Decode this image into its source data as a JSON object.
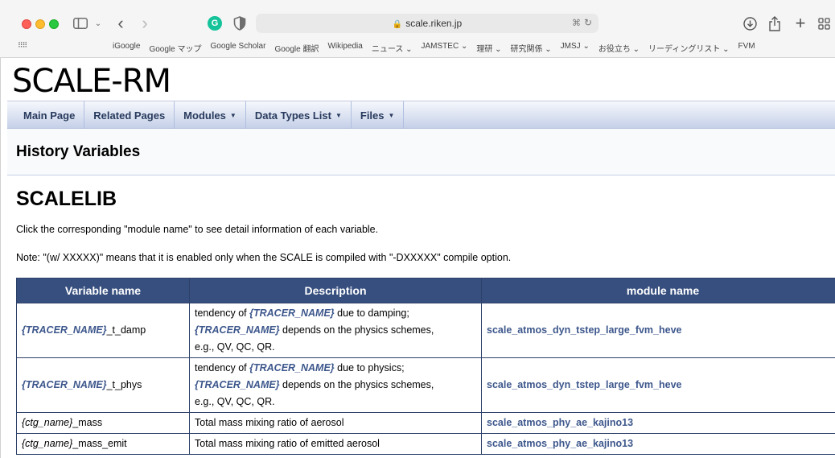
{
  "browser": {
    "url": "scale.riken.jp",
    "grammarly_letter": "G",
    "bookmarks": [
      "iGoogle",
      "Google マップ",
      "Google Scholar",
      "Google 翻訳",
      "Wikipedia",
      "ニュース ⌄",
      "JAMSTEC ⌄",
      "理研 ⌄",
      "研究関係 ⌄",
      "JMSJ ⌄",
      "お役立ち ⌄",
      "リーディングリスト ⌄",
      "FVM"
    ]
  },
  "site": {
    "project_name": "SCALE-RM",
    "nav": [
      {
        "label": "Main Page",
        "dropdown": false
      },
      {
        "label": "Related Pages",
        "dropdown": false
      },
      {
        "label": "Modules",
        "dropdown": true
      },
      {
        "label": "Data Types List",
        "dropdown": true
      },
      {
        "label": "Files",
        "dropdown": true
      }
    ],
    "page_title": "History Variables"
  },
  "content": {
    "heading": "SCALELIB",
    "para1": "Click the corresponding \"module name\" to see detail information of each variable.",
    "para2": "Note: \"(w/ XXXXX)\" means that it is enabled only when the SCALE is compiled with \"-DXXXXX\" compile option.",
    "table": {
      "headers": [
        "Variable name",
        "Description",
        "module name"
      ],
      "rows": [
        {
          "var_prefix": "{TRACER_NAME}",
          "var_suffix": "_t_damp",
          "desc_a": "tendency of ",
          "desc_b": "{TRACER_NAME}",
          "desc_c": " due to damping;",
          "desc_d": "{TRACER_NAME}",
          "desc_e": " depends on the physics schemes,",
          "desc_f": "e.g., QV, QC, QR.",
          "module": "scale_atmos_dyn_tstep_large_fvm_heve"
        },
        {
          "var_prefix": "{TRACER_NAME}",
          "var_suffix": "_t_phys",
          "desc_a": "tendency of ",
          "desc_b": "{TRACER_NAME}",
          "desc_c": " due to physics;",
          "desc_d": "{TRACER_NAME}",
          "desc_e": " depends on the physics schemes,",
          "desc_f": "e.g., QV, QC, QR.",
          "module": "scale_atmos_dyn_tstep_large_fvm_heve"
        },
        {
          "var_prefix": "{ctg_name}",
          "var_suffix": "_mass",
          "desc": "Total mass mixing ratio of aerosol",
          "module": "scale_atmos_phy_ae_kajino13"
        },
        {
          "var_prefix": "{ctg_name}",
          "var_suffix": "_mass_emit",
          "desc": "Total mass mixing ratio of emitted aerosol",
          "module": "scale_atmos_phy_ae_kajino13"
        }
      ]
    }
  }
}
